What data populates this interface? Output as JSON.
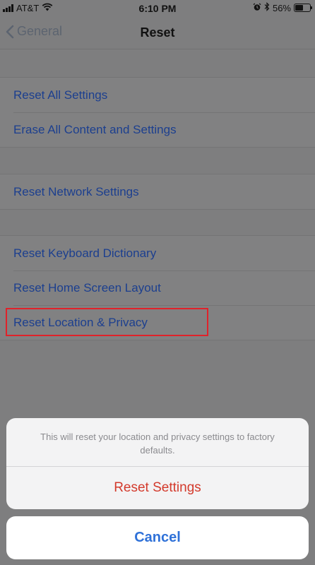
{
  "status_bar": {
    "carrier": "AT&T",
    "time": "6:10 PM",
    "battery": "56%",
    "battery_level": 0.56
  },
  "nav": {
    "back_label": "General",
    "title": "Reset"
  },
  "groups": [
    {
      "items": [
        "Reset All Settings",
        "Erase All Content and Settings"
      ]
    },
    {
      "items": [
        "Reset Network Settings"
      ]
    },
    {
      "items": [
        "Reset Keyboard Dictionary",
        "Reset Home Screen Layout",
        "Reset Location & Privacy"
      ]
    }
  ],
  "highlighted_item": "Reset Location & Privacy",
  "action_sheet": {
    "message": "This will reset your location and privacy settings to factory defaults.",
    "destructive_label": "Reset Settings",
    "cancel_label": "Cancel"
  },
  "colors": {
    "link_blue": "#1c3f8f",
    "destructive_red": "#d33a2c",
    "cancel_blue": "#2f71d8",
    "highlight_red": "#e0222a"
  },
  "icons": {
    "signal": "cellular-signal-icon",
    "wifi": "wifi-icon",
    "alarm": "alarm-clock-icon",
    "bluetooth": "bluetooth-icon",
    "battery": "battery-icon",
    "back": "chevron-left-icon"
  }
}
